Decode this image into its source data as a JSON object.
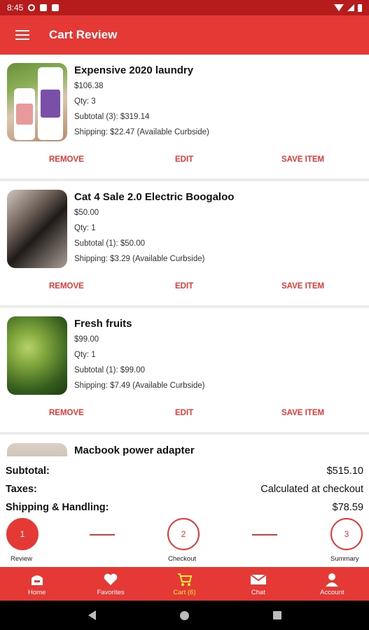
{
  "status_bar": {
    "time": "8:45"
  },
  "app_bar": {
    "title": "Cart Review",
    "menu_icon": "hamburger-menu-icon"
  },
  "cart_items": [
    {
      "name": "Expensive 2020 laundry",
      "price": "$106.38",
      "qty": "Qty: 3",
      "subtotal": "Subtotal (3):   $319.14",
      "shipping": "Shipping: $22.47 (Available Curbside)"
    },
    {
      "name": "Cat 4 Sale 2.0 Electric Boogaloo",
      "price": "$50.00",
      "qty": "Qty: 1",
      "subtotal": "Subtotal (1):   $50.00",
      "shipping": "Shipping: $3.29 (Available Curbside)"
    },
    {
      "name": "Fresh fruits",
      "price": "$99.00",
      "qty": "Qty: 1",
      "subtotal": "Subtotal (1):   $99.00",
      "shipping": "Shipping: $7.49 (Available Curbside)"
    },
    {
      "name": "Macbook power adapter"
    }
  ],
  "actions": {
    "remove": "REMOVE",
    "edit": "EDIT",
    "save": "SAVE ITEM"
  },
  "totals": {
    "subtotal_label": "Subtotal:",
    "subtotal_value": "$515.10",
    "taxes_label": "Taxes:",
    "taxes_value": "Calculated at checkout",
    "shipping_label": "Shipping & Handling:",
    "shipping_value": "$78.59"
  },
  "steps": [
    {
      "number": "1",
      "label": "Review"
    },
    {
      "number": "2",
      "label": "Checkout"
    },
    {
      "number": "3",
      "label": "Summary"
    }
  ],
  "bottom_nav": [
    {
      "label": "Home",
      "icon": "home-icon"
    },
    {
      "label": "Favorites",
      "icon": "heart-icon"
    },
    {
      "label": "Cart (6)",
      "icon": "cart-icon"
    },
    {
      "label": "Chat",
      "icon": "mail-icon"
    },
    {
      "label": "Account",
      "icon": "person-icon"
    }
  ],
  "colors": {
    "primary": "#e53935",
    "status_bar": "#b71c1c",
    "active_nav": "#ffeb3b"
  }
}
